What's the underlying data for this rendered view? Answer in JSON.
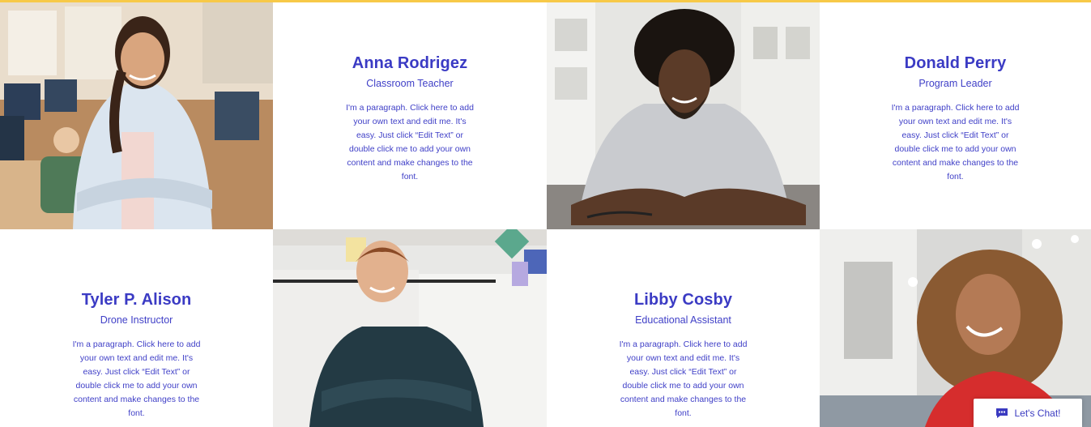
{
  "team": [
    {
      "name": "Anna Rodrigez",
      "role": "Classroom Teacher",
      "bio": "I'm a paragraph. Click here to add your own text and edit me. It's easy. Just click “Edit Text” or double click me to add your own content and make changes to the font."
    },
    {
      "name": "Donald Perry",
      "role": "Program Leader",
      "bio": "I'm a paragraph. Click here to add your own text and edit me. It's easy. Just click “Edit Text” or double click me to add your own content and make changes to the font."
    },
    {
      "name": "Tyler P. Alison",
      "role": "Drone Instructor",
      "bio": "I'm a paragraph. Click here to add your own text and edit me. It's easy. Just click “Edit Text” or double click me to add your own content and make changes to the font."
    },
    {
      "name": "Libby Cosby",
      "role": "Educational Assistant",
      "bio": "I'm a paragraph. Click here to add your own text and edit me. It's easy. Just click “Edit Text” or double click me to add your own content and make changes to the font."
    }
  ],
  "chat": {
    "label": "Let's Chat!",
    "icon": "chat-bubble-icon"
  },
  "colors": {
    "accent": "#3b3bc4",
    "top_rule": "#f7c948"
  }
}
